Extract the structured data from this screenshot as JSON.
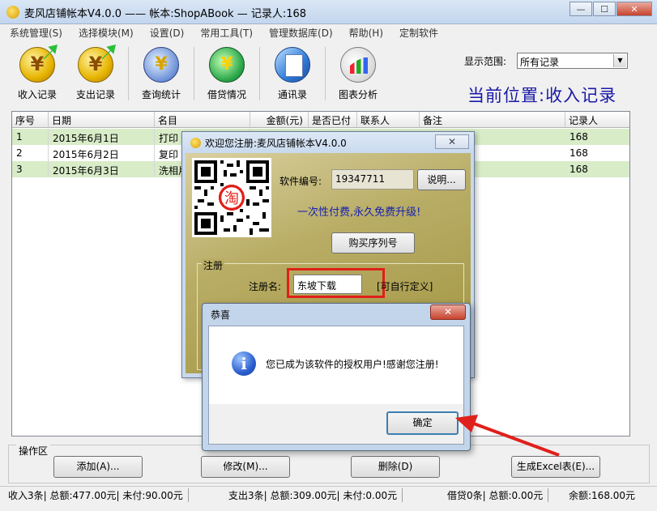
{
  "window": {
    "title": "麦风店铺帐本V4.0.0  ——  帐本:ShopABook — 记录人:168",
    "buttons": {
      "minimize": "—",
      "maximize": "☐",
      "close": "✕"
    }
  },
  "menu": [
    "系统管理(S)",
    "选择模块(M)",
    "设置(D)",
    "常用工具(T)",
    "管理数据库(D)",
    "帮助(H)",
    "定制软件"
  ],
  "toolbar": [
    {
      "label": "收入记录",
      "icon": "income-coin-icon"
    },
    {
      "label": "支出记录",
      "icon": "expense-coin-icon"
    },
    {
      "label": "查询统计",
      "icon": "search-stats-icon"
    },
    {
      "label": "借贷情况",
      "icon": "loan-cycle-icon"
    },
    {
      "label": "通讯录",
      "icon": "address-book-icon"
    },
    {
      "label": "图表分析",
      "icon": "chart-icon"
    }
  ],
  "range": {
    "label": "显示范围:",
    "value": "所有记录"
  },
  "position": "当前位置:收入记录",
  "table": {
    "headers": [
      "序号",
      "日期",
      "名目",
      "金额(元)",
      "是否已付",
      "联系人",
      "备注",
      "记录人"
    ],
    "rows": [
      [
        "1",
        "2015年6月1日",
        "打印",
        "",
        "",
        "",
        "",
        "168"
      ],
      [
        "2",
        "2015年6月2日",
        "复印",
        "",
        "",
        "",
        "",
        "168"
      ],
      [
        "3",
        "2015年6月3日",
        "洗相片",
        "",
        "",
        "",
        "",
        "168"
      ]
    ]
  },
  "ops": {
    "label": "操作区",
    "add": "添加(A)...",
    "edit": "修改(M)...",
    "delete": "删除(D)",
    "excel": "生成Excel表(E)..."
  },
  "status": {
    "income": "收入3条| 总额:477.00元| 未付:90.00元",
    "expense": "支出3条| 总额:309.00元| 未付:0.00元",
    "loan": "借贷0条| 总额:0.00元",
    "balance": "余额:168.00元"
  },
  "reg_dialog": {
    "title": "欢迎您注册:麦风店铺帐本V4.0.0",
    "close": "✕",
    "sn_label": "软件编号:",
    "sn_value": "19347711",
    "explain_button": "说明...",
    "promo": "一次性付费,永久免费升级!",
    "buy_button": "购买序列号",
    "group_label": "注册",
    "name_label": "注册名:",
    "name_value": "东坡下载",
    "custom_hint": "[可自行定义]"
  },
  "msgbox": {
    "title": "恭喜",
    "close": "✕",
    "text": "您已成为该软件的授权用户!感谢您注册!",
    "ok": "确定"
  },
  "colors": {
    "alt_row": "#d8ecc8",
    "accent_blue": "#1a1aa8",
    "red_highlight": "#e0201a"
  }
}
